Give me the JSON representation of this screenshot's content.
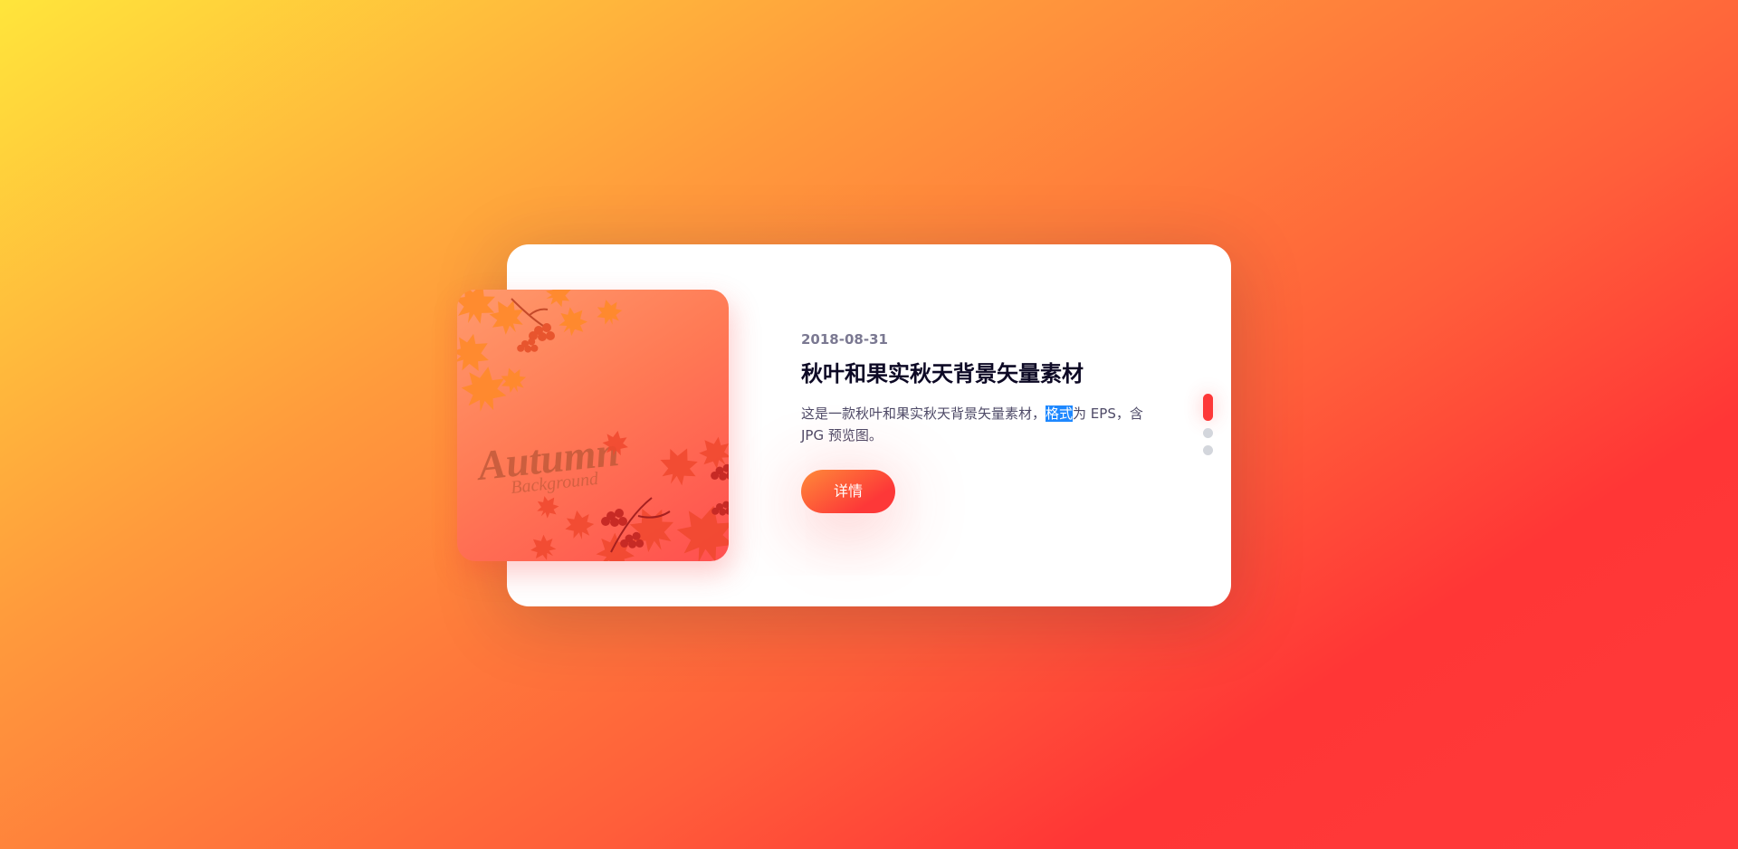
{
  "slide": {
    "date": "2018-08-31",
    "title": "秋叶和果实秋天背景矢量素材",
    "text_before": "这是一款秋叶和果实秋天背景矢量素材，",
    "text_selected": "格式",
    "text_after": "为 EPS，含 JPG 预览图。",
    "button_label": "详情",
    "image_title": "Autumn",
    "image_subtitle": "Background"
  },
  "pagination": {
    "count": 3,
    "active_index": 0
  },
  "colors": {
    "accent": "#fd3838",
    "selection": "#1e88ff",
    "title": "#0d0925",
    "text": "#4e4a67",
    "date": "#7b7992"
  },
  "icons": [
    "autumn-leaf-icon",
    "berry-cluster-icon"
  ]
}
